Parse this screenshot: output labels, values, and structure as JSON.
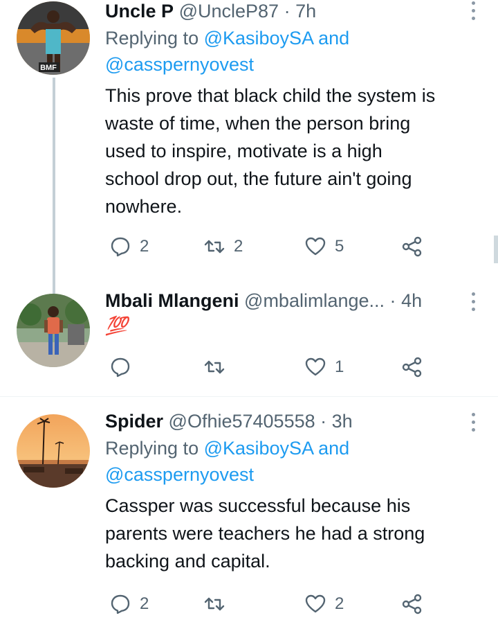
{
  "tweets": [
    {
      "name": "Uncle P",
      "handle": "@UncleP87",
      "separator": "·",
      "time": "7h",
      "replying_prefix": "Replying to ",
      "replying_user1": "@KasiboySA",
      "replying_and": " and",
      "replying_user2": "@casspernyovest",
      "text_lines": [
        "This prove that black child the system is",
        "waste of time, when the person bring",
        "used to inspire, motivate is a high",
        "school drop out, the future ain't going",
        "nowhere."
      ],
      "reply_count": "2",
      "retweet_count": "2",
      "like_count": "5",
      "avatar_label": "BMF"
    },
    {
      "name": "Mbali Mlangeni",
      "handle": "@mbalimlange...",
      "separator": "·",
      "time": "4h",
      "text": "💯",
      "reply_count": "",
      "retweet_count": "",
      "like_count": "1"
    },
    {
      "name": "Spider",
      "handle": "@Ofhie57405558",
      "separator": "·",
      "time": "3h",
      "replying_prefix": "Replying to ",
      "replying_user1": "@KasiboySA",
      "replying_and": " and",
      "replying_user2": "@casspernyovest",
      "text_lines": [
        "Cassper was successful because his",
        "parents were teachers he had a strong",
        "backing and capital."
      ],
      "reply_count": "2",
      "retweet_count": "",
      "like_count": "2"
    }
  ],
  "colors": {
    "link": "#1d9bf0",
    "secondary": "#536471",
    "text": "#0f1419",
    "thread_line": "#c4cfd6"
  }
}
